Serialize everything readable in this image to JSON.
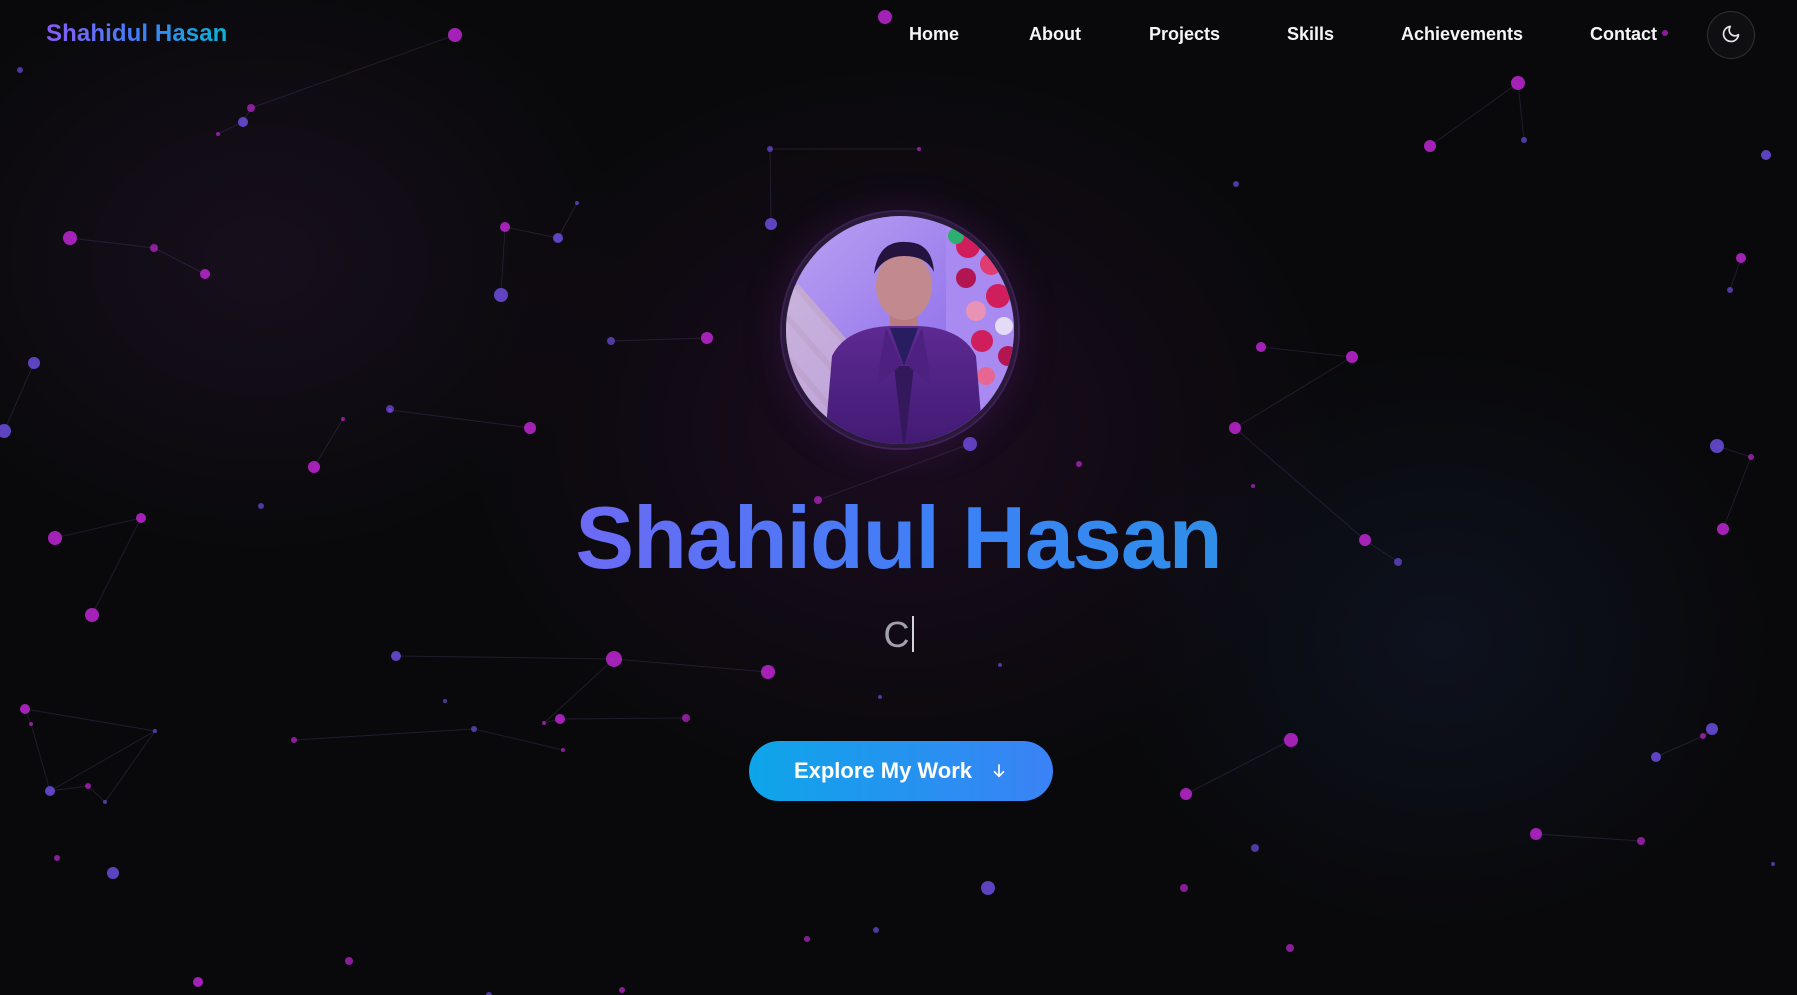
{
  "brand": "Shahidul Hasan",
  "nav": {
    "links": [
      "Home",
      "About",
      "Projects",
      "Skills",
      "Achievements",
      "Contact"
    ],
    "theme_toggle_icon": "moon-icon"
  },
  "hero": {
    "name": "Shahidul Hasan",
    "typed_text": "C",
    "avatar_alt": "Profile photo",
    "cta_label": "Explore My Work",
    "cta_icon": "arrow-down-icon"
  },
  "colors": {
    "background": "#09090b",
    "accent_purple": "#8b5cf6",
    "accent_blue": "#3b82f6",
    "accent_cyan": "#0ea5e9",
    "particle_pink": "#c026d3",
    "particle_violet": "#6d4de0"
  }
}
